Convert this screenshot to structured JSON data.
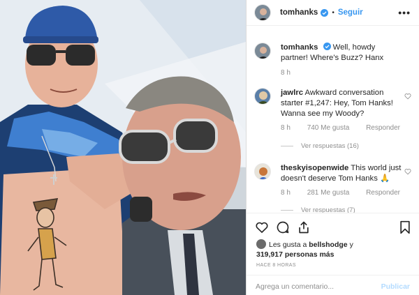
{
  "post": {
    "username": "tomhanks",
    "separator": "•",
    "follow_label": "Seguir",
    "more_label": "•••"
  },
  "caption": {
    "username": "tomhanks",
    "text": "Well, howdy partner! Where's Buzz? Hanx",
    "time": "8 h"
  },
  "comments": [
    {
      "username": "jawlrc",
      "text": "Awkward conversation starter #1,247: Hey, Tom Hanks! Wanna see my Woody?",
      "time": "8 h",
      "likes": "740 Me gusta",
      "reply_label": "Responder",
      "replies_label": "Ver respuestas (16)"
    },
    {
      "username": "theskyisopenwide",
      "text": "This world just doesn't deserve Tom Hanks 🙏",
      "time": "8 h",
      "likes": "281 Me gusta",
      "reply_label": "Responder",
      "replies_label": "Ver respuestas (7)"
    }
  ],
  "likes": {
    "prefix": "Les gusta a",
    "user": "bellshodge",
    "connector": "y",
    "count": "319,917 personas más"
  },
  "timestamp": "HACE 8 HORAS",
  "comment_box": {
    "placeholder": "Agrega un comentario...",
    "publish_label": "Publicar"
  },
  "colors": {
    "accent": "#3897f0",
    "verified": "#3897f0",
    "muted": "#8e8e8e",
    "publish_disabled": "#b3dbff"
  },
  "icons": [
    "heart-icon",
    "comment-icon",
    "share-icon",
    "bookmark-icon",
    "more-icon",
    "verified-badge-icon"
  ]
}
